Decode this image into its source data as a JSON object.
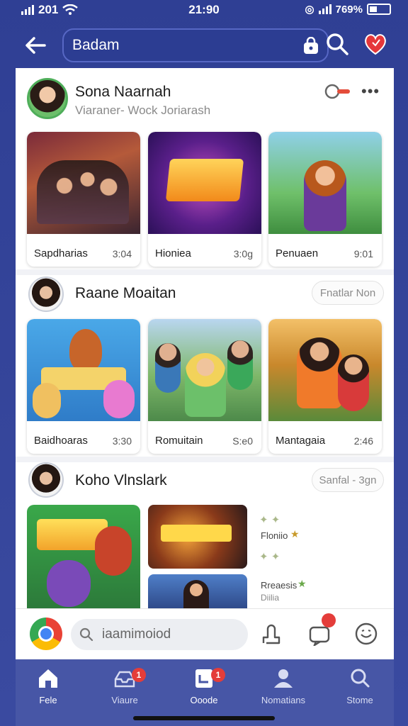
{
  "status_bar": {
    "carrier": "201",
    "time": "21:90",
    "battery": "769%"
  },
  "header": {
    "search_value": "Badam"
  },
  "feed": [
    {
      "name": "Sona Naarnah",
      "subtitle": "Viaraner- Wock Joriarash",
      "tiles": [
        {
          "label": "Sapdharias",
          "meta": "3:04"
        },
        {
          "label": "Hioniea",
          "meta": "3:0g"
        },
        {
          "label": "Penuaen",
          "meta": "9:01"
        }
      ]
    },
    {
      "name": "Raane Moaitan",
      "chip": "Fnatlar  Non",
      "tiles": [
        {
          "label": "Baidhoaras",
          "meta": "3:30"
        },
        {
          "label": "Romuitain",
          "meta": "S:e0"
        },
        {
          "label": "Mantagaia",
          "meta": "2:46"
        }
      ]
    },
    {
      "name": "Koho Vlnslark",
      "chip": "Sanfal -  3gn",
      "side_labels": [
        "Floniio",
        "Rreaesis",
        "Diilia"
      ]
    }
  ],
  "composer": {
    "search_placeholder": "iaamimoiod"
  },
  "tabs": [
    {
      "label": "Fele"
    },
    {
      "label": "Viaure",
      "badge": "1"
    },
    {
      "label": "Ooode",
      "badge": "1"
    },
    {
      "label": "Nomatians"
    },
    {
      "label": "Stome"
    }
  ],
  "colors": {
    "accent": "#2f3f94",
    "badge": "#e43d3a",
    "tabbar": "#4756a6"
  }
}
